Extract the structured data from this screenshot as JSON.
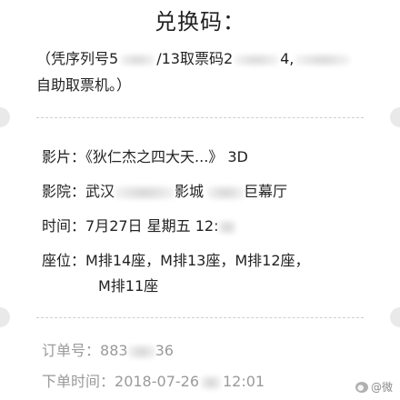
{
  "header": {
    "title": "兑换码："
  },
  "pickup_note": {
    "line1_a": "（凭序列号5",
    "line1_b": "/13取票码2",
    "line1_c": "4,",
    "line2": "自助取票机。）"
  },
  "details": {
    "film_label": "影片：",
    "film_value": "《狄仁杰之四大天...》 3D",
    "cinema_label": "影院：",
    "cinema_city": "武汉",
    "cinema_part": "影城",
    "cinema_hall": "巨幕厅",
    "time_label": "时间：",
    "time_value": "7月27日 星期五 12:",
    "seat_label": "座位：",
    "seat_line1": "M排14座，M排13座，M排12座，",
    "seat_line2": "M排11座"
  },
  "order": {
    "number_label": "订单号：",
    "number_a": "883",
    "number_b": "36",
    "time_label": "下单时间：",
    "time_a": "2018-07-26",
    "time_b": "12:01"
  },
  "watermark": {
    "text": "@微"
  },
  "colors": {
    "text": "#222222",
    "muted": "#9a9a9a",
    "notch": "#e9e9e9",
    "divider": "#cfcfcf"
  }
}
